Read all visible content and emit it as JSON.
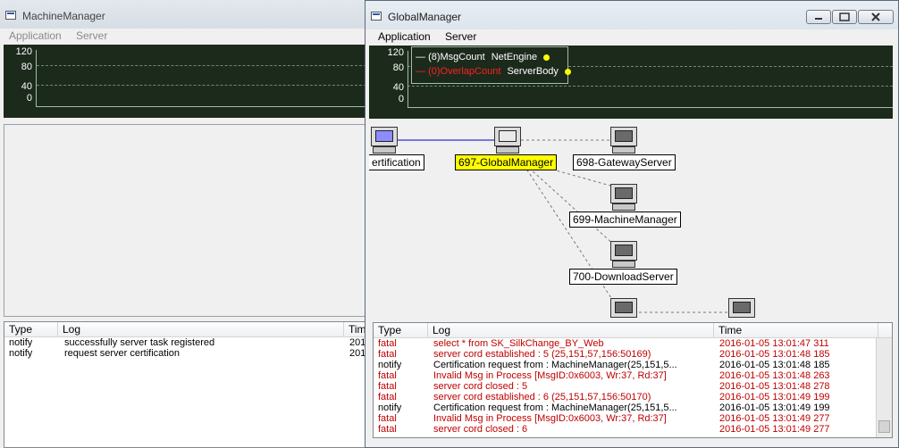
{
  "left_window": {
    "title": "MachineManager",
    "menu": [
      "Application",
      "Server"
    ],
    "graph": {
      "y_labels": [
        "120",
        "80",
        "40",
        "0"
      ]
    },
    "log": {
      "columns": [
        "Type",
        "Log",
        "Tim"
      ],
      "rows": [
        {
          "type": "notify",
          "log": "successfully server task registered",
          "time": "201"
        },
        {
          "type": "notify",
          "log": "request server certification",
          "time": "201"
        }
      ]
    }
  },
  "right_window": {
    "title": "GlobalManager",
    "menu": [
      "Application",
      "Server"
    ],
    "graph": {
      "y_labels": [
        "120",
        "80",
        "40",
        "0"
      ],
      "legend": [
        {
          "marker": "—",
          "label": "(8)MsgCount",
          "server": "NetEngine",
          "color": "#ffffff"
        },
        {
          "marker": "—",
          "label": "(0)OverlapCount",
          "server": "ServerBody",
          "color": "#ff2020"
        }
      ]
    },
    "nodes": [
      {
        "label": "ertification",
        "selected": false,
        "icon": "computer-icon-blue"
      },
      {
        "label": "697-GlobalManager",
        "selected": true,
        "icon": "computer-icon"
      },
      {
        "label": "698-GatewayServer",
        "selected": false,
        "icon": "computer-icon"
      },
      {
        "label": "699-MachineManager",
        "selected": false,
        "icon": "computer-icon"
      },
      {
        "label": "700-DownloadServer",
        "selected": false,
        "icon": "computer-icon"
      }
    ],
    "log": {
      "columns": [
        "Type",
        "Log",
        "Time"
      ],
      "rows": [
        {
          "type": "fatal",
          "log": "select * from SK_SilkChange_BY_Web",
          "time": "2016-01-05 13:01:47 311"
        },
        {
          "type": "fatal",
          "log": "server cord established : 5 (25,151,57,156:50169)",
          "time": "2016-01-05 13:01:48 185"
        },
        {
          "type": "notify",
          "log": "Certification request from : MachineManager(25,151,5...",
          "time": "2016-01-05 13:01:48 185"
        },
        {
          "type": "fatal",
          "log": "Invalid Msg in Process [MsgID:0x6003, Wr:37, Rd:37]",
          "time": "2016-01-05 13:01:48 263"
        },
        {
          "type": "fatal",
          "log": "server cord closed : 5",
          "time": "2016-01-05 13:01:48 278"
        },
        {
          "type": "fatal",
          "log": "server cord established : 6 (25,151,57,156:50170)",
          "time": "2016-01-05 13:01:49 199"
        },
        {
          "type": "notify",
          "log": "Certification request from : MachineManager(25,151,5...",
          "time": "2016-01-05 13:01:49 199"
        },
        {
          "type": "fatal",
          "log": "Invalid Msg in Process [MsgID:0x6003, Wr:37, Rd:37]",
          "time": "2016-01-05 13:01:49 277"
        },
        {
          "type": "fatal",
          "log": "server cord closed : 6",
          "time": "2016-01-05 13:01:49 277"
        }
      ]
    }
  },
  "colors": {
    "fatal": "#c00000",
    "selected_node": "#ffff00",
    "graph_bg": "#1c2a1c",
    "link_solid": "#0000cc"
  }
}
